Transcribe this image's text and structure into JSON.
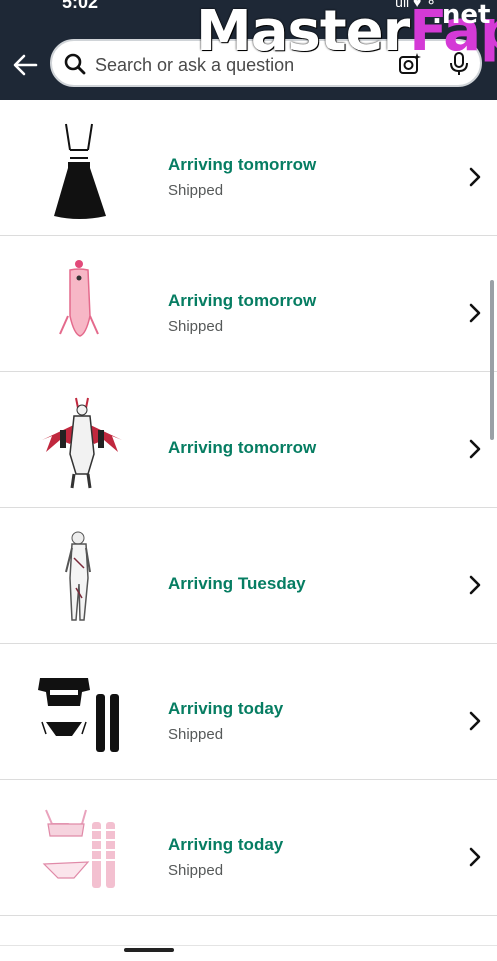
{
  "status_bar": {
    "time": "5:02",
    "icons": "ull ♥ ⚬"
  },
  "search": {
    "placeholder": "Search or ask a question"
  },
  "watermark": {
    "main": "Master",
    "accent": "Fap",
    "suffix": ".net"
  },
  "orders": [
    {
      "status": "Arriving tomorrow",
      "sub": "Shipped",
      "thumb": "black-skirt-icon"
    },
    {
      "status": "Arriving tomorrow",
      "sub": "Shipped",
      "thumb": "pink-bodysuit-icon"
    },
    {
      "status": "Arriving tomorrow",
      "sub": "",
      "thumb": "winged-costume-icon"
    },
    {
      "status": "Arriving Tuesday",
      "sub": "",
      "thumb": "white-bodysuit-icon"
    },
    {
      "status": "Arriving today",
      "sub": "Shipped",
      "thumb": "black-set-icon"
    },
    {
      "status": "Arriving today",
      "sub": "Shipped",
      "thumb": "pink-set-icon"
    }
  ],
  "colors": {
    "header": "#1e2836",
    "status_green": "#067d62",
    "sub_gray": "#565959"
  }
}
